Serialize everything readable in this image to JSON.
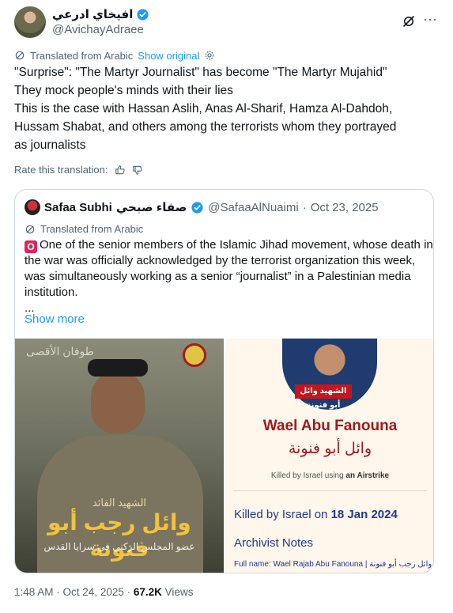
{
  "tweet": {
    "display_name": "افيخاي ادرعي",
    "handle": "@AvichayAdraee",
    "translated_label": "Translated from Arabic",
    "show_original": "Show original",
    "lines": [
      "\"Surprise\": \"The Martyr Journalist\" has become \"The Martyr Mujahid\"",
      "They mock people's minds with their lies",
      "This is the case with Hassan Aslih, Anas Al-Sharif, Hamza Al-Dahdoh,",
      "Hussam Shabat, and others among the terrorists whom they portrayed",
      "as journalists"
    ],
    "rate_label": "Rate this translation:",
    "time": "1:48 AM",
    "date": "Oct 24, 2025",
    "views_count": "67.2K",
    "views_label": "Views"
  },
  "quote": {
    "name": "Safaa Subhi",
    "name_ar": "صفاء صبحي",
    "handle": "@SafaaAlNuaimi",
    "date": "Oct 23, 2025",
    "translated_label": "Translated from Arabic",
    "badge": "O",
    "lines": [
      "One of the senior members of the Islamic Jihad movement, whose death in",
      "the war was officially acknowledged by the terrorist organization this week,",
      "was simultaneously working as a senior “journalist” in a Palestinian media",
      "institution.",
      "..."
    ],
    "show_more": "Show more"
  },
  "image_left": {
    "calligraphy": "طوفان الأقصى",
    "title": "الشهيد القائد",
    "name": "وائل رجب أبو فنونة",
    "subtitle": "عضو المجلس الركني في سرايا القدس"
  },
  "image_right": {
    "ribbon": "الشهيد وائل أبو فنونة",
    "name_en": "Wael Abu Fanouna",
    "name_ar": "وائل أبو فنونة",
    "killed_by_prefix": "Killed by Israel using",
    "killed_by_method": "an Airstrike",
    "killed_date_prefix": "Killed by Israel on",
    "killed_date": "18 Jan 2024",
    "notes_heading": "Archivist Notes",
    "full_name": "Full name: Wael Rajab Abu Fanouna | وائل رجب أبو فنونة"
  },
  "colors": {
    "link": "#1d9bf0",
    "muted": "#536471",
    "verified": "#1d9bf0"
  }
}
